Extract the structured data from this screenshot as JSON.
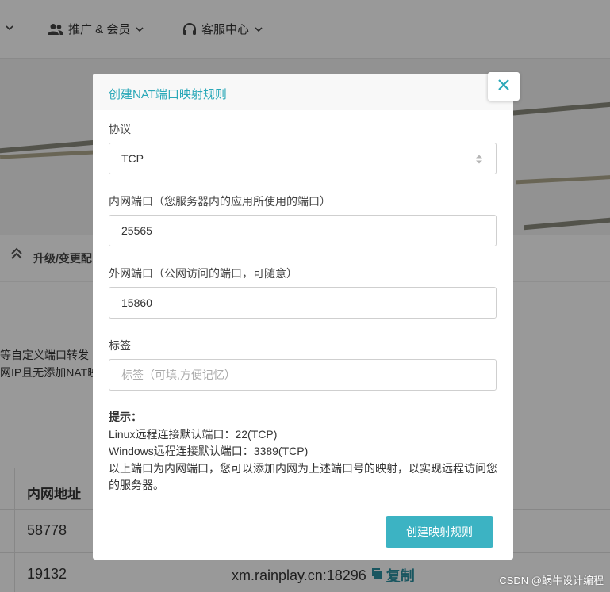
{
  "background": {
    "nav": {
      "promo_label": "推广 & 会员",
      "service_label": "客服中心"
    },
    "section_title": "升级/变更配",
    "text_line1": "等自定义端口转发",
    "text_line2": "网IP且无添加NAT映",
    "table": {
      "header_inner_address": "内网地址",
      "rows": [
        {
          "port": "58778",
          "address": ""
        },
        {
          "port": "19132",
          "address": "xm.rainplay.cn:18296"
        }
      ],
      "copy_label": "复制"
    }
  },
  "modal": {
    "title": "创建NAT端口映射规则",
    "protocol": {
      "label": "协议",
      "value": "TCP"
    },
    "internal_port": {
      "label": "内网端口（您服务器内的应用所使用的端口）",
      "value": "25565"
    },
    "external_port": {
      "label": "外网端口（公网访问的端口，可随意）",
      "value": "15860"
    },
    "tag": {
      "label": "标签",
      "placeholder": "标签（可填,方便记忆）"
    },
    "hint": {
      "title": "提示：",
      "line1": "Linux远程连接默认端口：22(TCP)",
      "line2": "Windows远程连接默认端口：3389(TCP)",
      "line3": "以上端口为内网端口，您可以添加内网为上述端口号的映射，以实现远程访问您的服务器。"
    },
    "submit_label": "创建映射规则"
  },
  "watermark": "CSDN @蜗牛设计编程",
  "colors": {
    "accent": "#3cb3c3",
    "title": "#2aa8b8"
  },
  "icons": [
    "users-icon",
    "headset-icon",
    "chevron-down-icon",
    "close-icon",
    "select-arrows-icon",
    "chevrons-up-icon",
    "copy-icon"
  ]
}
